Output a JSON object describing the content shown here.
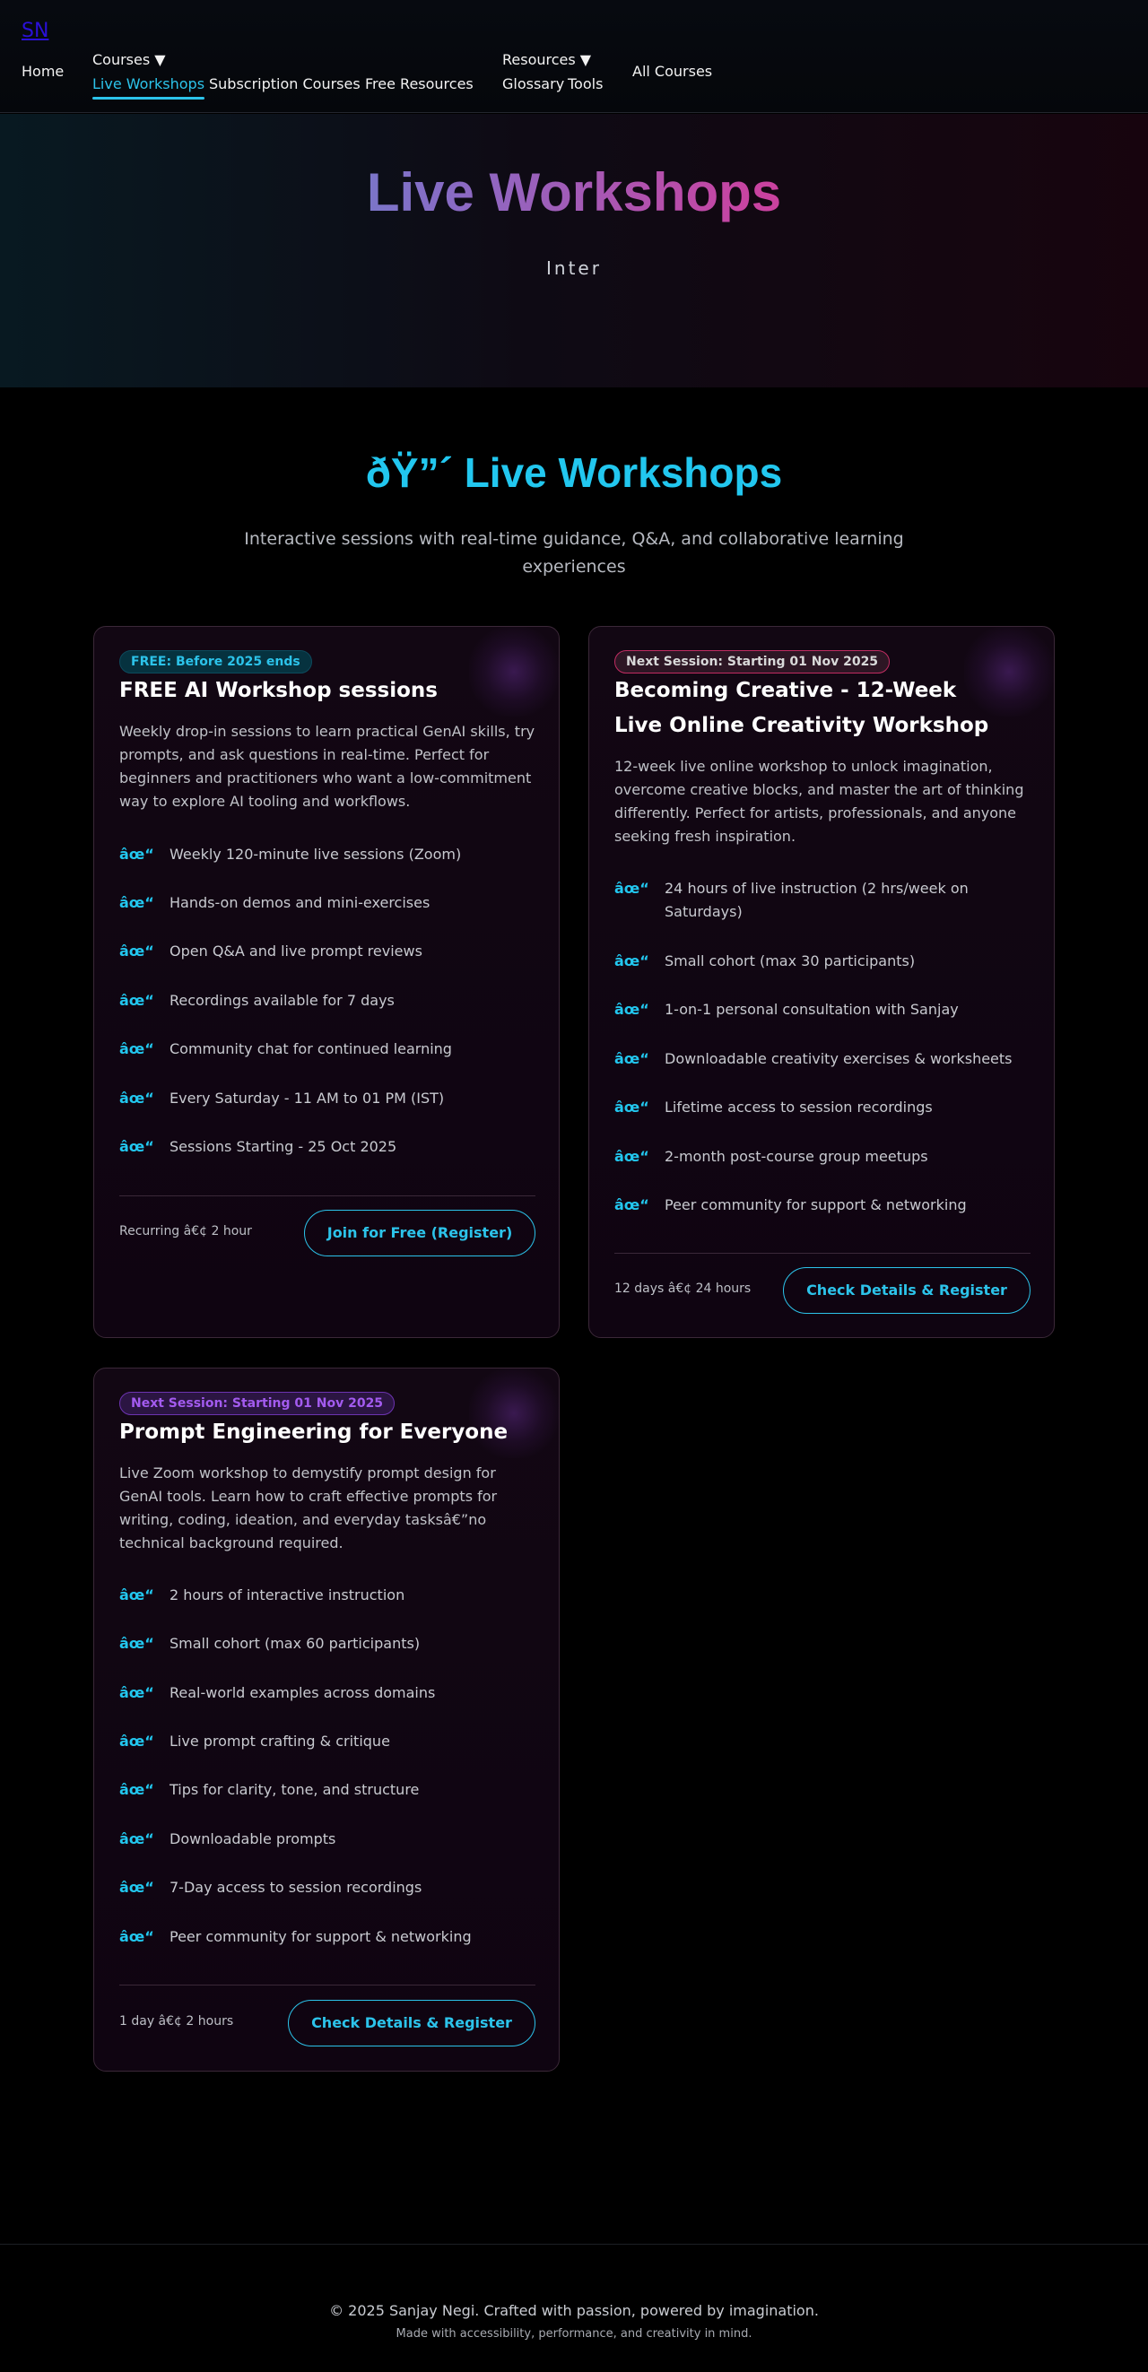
{
  "nav": {
    "logo": "SN",
    "home": "Home",
    "courses_menu": "Courses ▼",
    "courses_items": [
      "Live Workshops",
      "Subscription Courses",
      "Free Resources"
    ],
    "resources_menu": "Resources ▼",
    "resources_items": [
      "Glossary",
      "Tools"
    ],
    "all_courses": "All Courses",
    "accent_color": "#2cc3ea"
  },
  "hero": {
    "title": "Live Workshops",
    "subtitle": "Inter"
  },
  "section": {
    "title": "ðŸ”´ Live Workshops",
    "subtitle": "Interactive sessions with real-time guidance, Q&A, and collaborative learning experiences"
  },
  "cards": [
    {
      "badge": "FREE: Before 2025 ends",
      "title": "FREE AI Workshop sessions",
      "description": "Weekly drop-in sessions to learn practical GenAI skills, try prompts, and ask questions in real-time. Perfect for beginners and practitioners who want a low-commitment way to explore AI tooling and workflows.",
      "tick": "âœ“",
      "features": [
        "Weekly 120-minute live sessions (Zoom)",
        "Hands-on demos and mini-exercises",
        "Open Q&A and live prompt reviews",
        "Recordings available for 7 days",
        "Community chat for continued learning",
        "Every Saturday - 11 AM to 01 PM (IST)",
        "Sessions Starting - 25 Oct 2025"
      ],
      "meta": "Recurring â€¢ 2 hour",
      "button": "Join for Free (Register)"
    },
    {
      "badge": "Next Session: Starting 01 Nov 2025",
      "title": "Becoming Creative - 12-Week Live Online Creativity Workshop",
      "description": "12-week live online workshop to unlock imagination, overcome creative blocks, and master the art of thinking differently. Perfect for artists, professionals, and anyone seeking fresh inspiration.",
      "tick": "âœ“",
      "features": [
        "24 hours of live instruction (2 hrs/week on Saturdays)",
        "Small cohort (max 30 participants)",
        "1-on-1 personal consultation with Sanjay",
        "Downloadable creativity exercises & worksheets",
        "Lifetime access to session recordings",
        "2-month post-course group meetups",
        "Peer community for support & networking"
      ],
      "meta": "12 days â€¢ 24 hours",
      "button": "Check Details & Register"
    },
    {
      "badge": "Next Session: Starting 01 Nov 2025",
      "title": "Prompt Engineering for Everyone",
      "description": "Live Zoom workshop to demystify prompt design for GenAI tools. Learn how to craft effective prompts for writing, coding, ideation, and everyday tasksâ€”no technical background required.",
      "tick": "âœ“",
      "features": [
        "2 hours of interactive instruction",
        "Small cohort (max 60 participants)",
        "Real-world examples across domains",
        "Live prompt crafting & critique",
        "Tips for clarity, tone, and structure",
        "Downloadable prompts",
        "7-Day access to session recordings",
        "Peer community for support & networking"
      ],
      "meta": "1 day â€¢ 2 hours",
      "button": "Check Details & Register"
    }
  ],
  "footer": {
    "main": "© 2025 Sanjay Negi. Crafted with passion, powered by imagination.",
    "sub": "Made with accessibility, performance, and creativity in mind."
  }
}
